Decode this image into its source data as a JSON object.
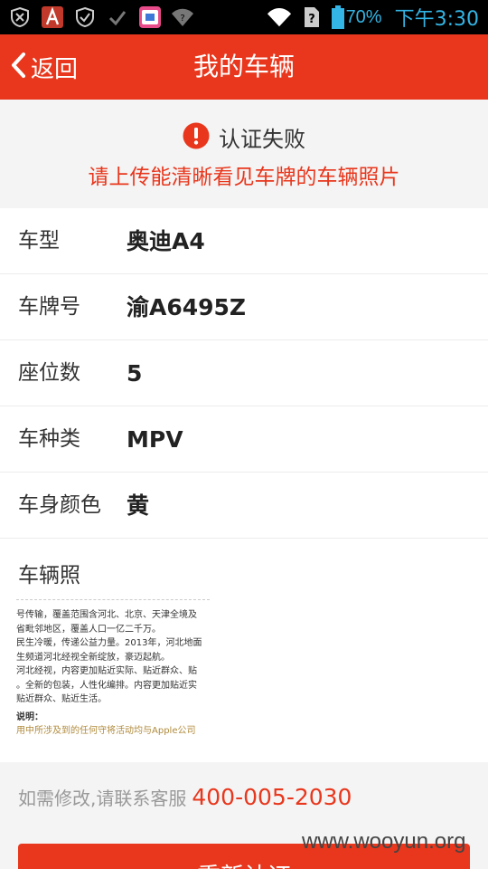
{
  "statusbar": {
    "battery_pct": "70%",
    "time": "下午3:30"
  },
  "nav": {
    "back_label": "返回",
    "title": "我的车辆"
  },
  "notice": {
    "title": "认证失败",
    "message": "请上传能清晰看见车牌的车辆照片"
  },
  "vehicle": [
    {
      "label": "车型",
      "value": "奥迪A4"
    },
    {
      "label": "车牌号",
      "value": "渝A6495Z"
    },
    {
      "label": "座位数",
      "value": "5"
    },
    {
      "label": "车种类",
      "value": "MPV"
    },
    {
      "label": "车身颜色",
      "value": "黄"
    }
  ],
  "photo_section": {
    "label": "车辆照",
    "text_lines": [
      "号传输，覆盖范围含河北、北京、天津全境及",
      "省毗邻地区，覆盖人口一亿二千万。",
      "民生冷暖，传递公益力量。2013年，河北地面",
      "生频道河北经视全新绽放，豪迈起航。",
      "河北经视，内容更加贴近实际、贴近群众、贴",
      "。全新的包装，人性化编排。内容更加贴近实",
      "贴近群众、贴近生活。",
      "说明：",
      "用中所涉及到的任何守将活动均与Apple公司"
    ]
  },
  "contact": {
    "text": "如需修改,请联系客服",
    "phone": "400-005-2030"
  },
  "submit_button_label": "重新认证",
  "watermark": "www.wooyun.org",
  "colors": {
    "brand_red": "#e8371d",
    "status_blue": "#33b5e5"
  }
}
